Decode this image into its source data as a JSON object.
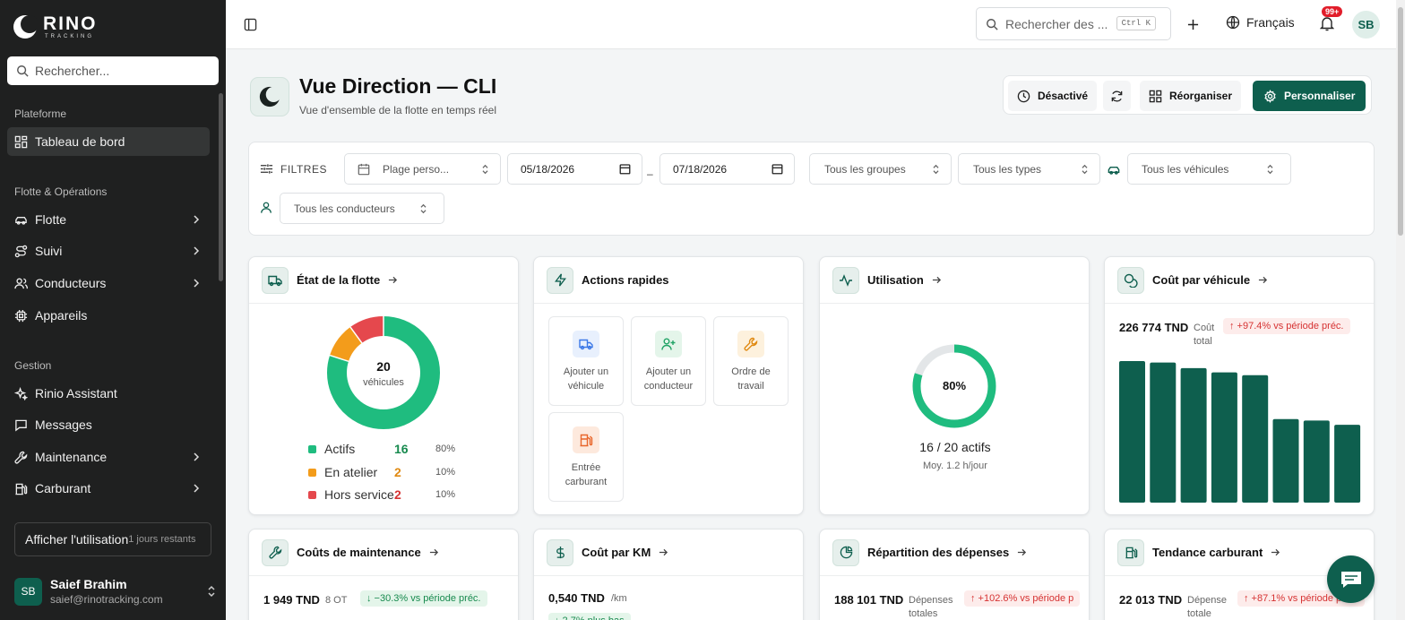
{
  "brand": {
    "name": "RINO",
    "sub": "TRACKING"
  },
  "sidebar": {
    "search_placeholder": "Rechercher...",
    "sections": {
      "platform": "Plateforme",
      "fleet_ops": "Flotte & Opérations",
      "management": "Gestion"
    },
    "items": {
      "dashboard": "Tableau de bord",
      "fleet": "Flotte",
      "tracking": "Suivi",
      "drivers": "Conducteurs",
      "devices": "Appareils",
      "assistant": "Rinio Assistant",
      "messages": "Messages",
      "maintenance": "Maintenance",
      "fuel": "Carburant"
    },
    "usage_label": "Afficher l'utilisation",
    "usage_days": "1 jours restants",
    "user": {
      "initials": "SB",
      "name": "Saief Brahim",
      "email": "saief@rinotracking.com"
    }
  },
  "topbar": {
    "search_placeholder": "Rechercher des ...",
    "shortcut": "Ctrl K",
    "language": "Français",
    "notif_badge": "99+",
    "avatar": "SB"
  },
  "page": {
    "title": "Vue Direction — CLI",
    "subtitle": "Vue d'ensemble de la flotte en temps réel"
  },
  "toolbar": {
    "disabled": "Désactivé",
    "reorganize": "Réorganiser",
    "customize": "Personnaliser"
  },
  "filters": {
    "label": "FILTRES",
    "range": "Plage perso...",
    "date_from": "05/18/2026",
    "date_to": "07/18/2026",
    "groups": "Tous les groupes",
    "types": "Tous les types",
    "vehicles": "Tous les véhicules",
    "drivers": "Tous les conducteurs"
  },
  "fleet_state": {
    "title": "État de la flotte",
    "total": "20",
    "total_label": "véhicules",
    "items": [
      {
        "label": "Actifs",
        "count": "16",
        "pct": "80%",
        "value": 16,
        "color": "#1fbc7f"
      },
      {
        "label": "En atelier",
        "count": "2",
        "pct": "10%",
        "value": 2,
        "color": "#f39c1b"
      },
      {
        "label": "Hors service",
        "count": "2",
        "pct": "10%",
        "value": 2,
        "color": "#e5484d"
      }
    ]
  },
  "quick_actions": {
    "title": "Actions rapides",
    "add_vehicle": [
      "Ajouter un",
      "véhicule"
    ],
    "add_driver": [
      "Ajouter un",
      "conducteur"
    ],
    "work_order": [
      "Ordre de",
      "travail"
    ],
    "fuel_entry": [
      "Entrée",
      "carburant"
    ]
  },
  "utilization": {
    "title": "Utilisation",
    "pct_label": "80%",
    "pct": 80,
    "actifs": "16 / 20 actifs",
    "avg": "Moy. 1.2 h/jour"
  },
  "cost_per_vehicle": {
    "title": "Coût par véhicule",
    "value": "226 774 TND",
    "label": [
      "Coût",
      "total"
    ],
    "delta": "↑ +97.4% vs période préc."
  },
  "maintenance_costs": {
    "title": "Coûts de maintenance",
    "value": "1 949 TND",
    "sub": "8 OT",
    "delta": "↓ −30.3% vs période préc."
  },
  "cost_per_km": {
    "title": "Coût par KM",
    "value": "0,540 TND",
    "unit": "/km",
    "delta": "↓ 2.7% plus bas"
  },
  "expense_split": {
    "title": "Répartition des dépenses",
    "value": "188 101 TND",
    "label": [
      "Dépenses",
      "totales"
    ],
    "delta": "↑ +102.6% vs période p"
  },
  "fuel_trend": {
    "title": "Tendance carburant",
    "value": "22 013 TND",
    "label": [
      "Dépense",
      "totale"
    ],
    "delta": "↑ +87.1% vs période préc."
  },
  "chart_data": {
    "type": "bar",
    "values": [
      100,
      99,
      95,
      92,
      90,
      59,
      58,
      55
    ],
    "ylim": [
      0,
      100
    ],
    "color": "#0e5f4e"
  }
}
